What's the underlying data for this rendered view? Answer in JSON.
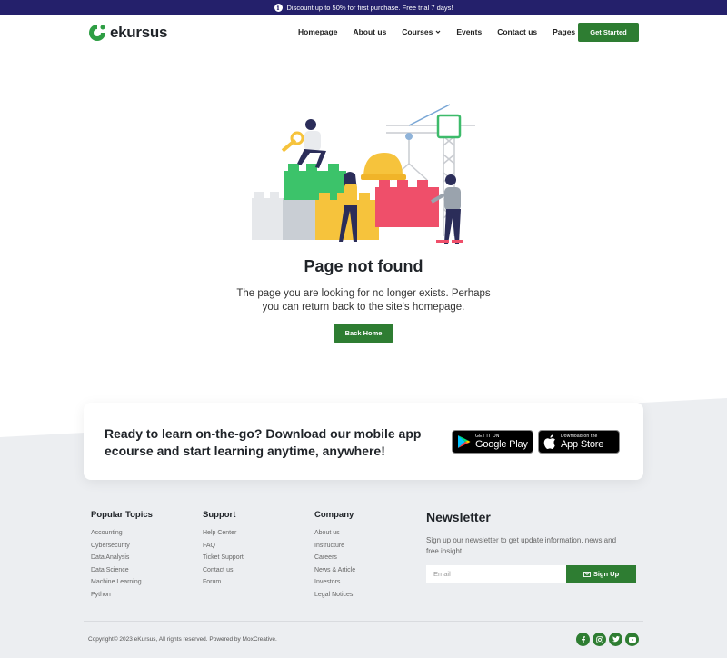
{
  "announcement": {
    "icon": "info-icon",
    "text": "Discount up to 50% for first purchase. Free trial 7 days!"
  },
  "header": {
    "logo_text": "ekursus",
    "nav": [
      {
        "label": "Homepage",
        "has_dropdown": false
      },
      {
        "label": "About us",
        "has_dropdown": false
      },
      {
        "label": "Courses",
        "has_dropdown": true
      },
      {
        "label": "Events",
        "has_dropdown": false
      },
      {
        "label": "Contact us",
        "has_dropdown": false
      },
      {
        "label": "Pages",
        "has_dropdown": true
      }
    ],
    "cta": "Get Started"
  },
  "main": {
    "title": "Page not found",
    "description": "The page you are looking for no longer exists. Perhaps you can return back to the site's homepage.",
    "button": "Back Home"
  },
  "app_promo": {
    "heading": "Ready to learn on-the-go? Download our mobile app ecourse and start learning anytime, anywhere!",
    "google_play": {
      "small": "GET IT ON",
      "big": "Google Play"
    },
    "app_store": {
      "small": "Download on the",
      "big": "App Store"
    }
  },
  "footer": {
    "columns": [
      {
        "title": "Popular Topics",
        "links": [
          "Accounting",
          "Cybersecurity",
          "Data Analysis",
          "Data Science",
          "Machine Learning",
          "Python"
        ]
      },
      {
        "title": "Support",
        "links": [
          "Help Center",
          "FAQ",
          "Ticket Support",
          "Contact us",
          "Forum"
        ]
      },
      {
        "title": "Company",
        "links": [
          "About us",
          "Instructure",
          "Careers",
          "News & Article",
          "Investors",
          "Legal Notices"
        ]
      }
    ],
    "newsletter": {
      "title": "Newsletter",
      "text": "Sign up our newsletter to get update information, news and free insight.",
      "placeholder": "Email",
      "button": "Sign Up"
    },
    "copyright": "Copyright© 2023 eKursus, All rights reserved. Powered by MoxCreative.",
    "socials": [
      "facebook-icon",
      "instagram-icon",
      "twitter-icon",
      "youtube-icon"
    ]
  },
  "colors": {
    "brand_green": "#2e7d32",
    "topbar_navy": "#24206b",
    "footer_bg": "#eceef1"
  }
}
